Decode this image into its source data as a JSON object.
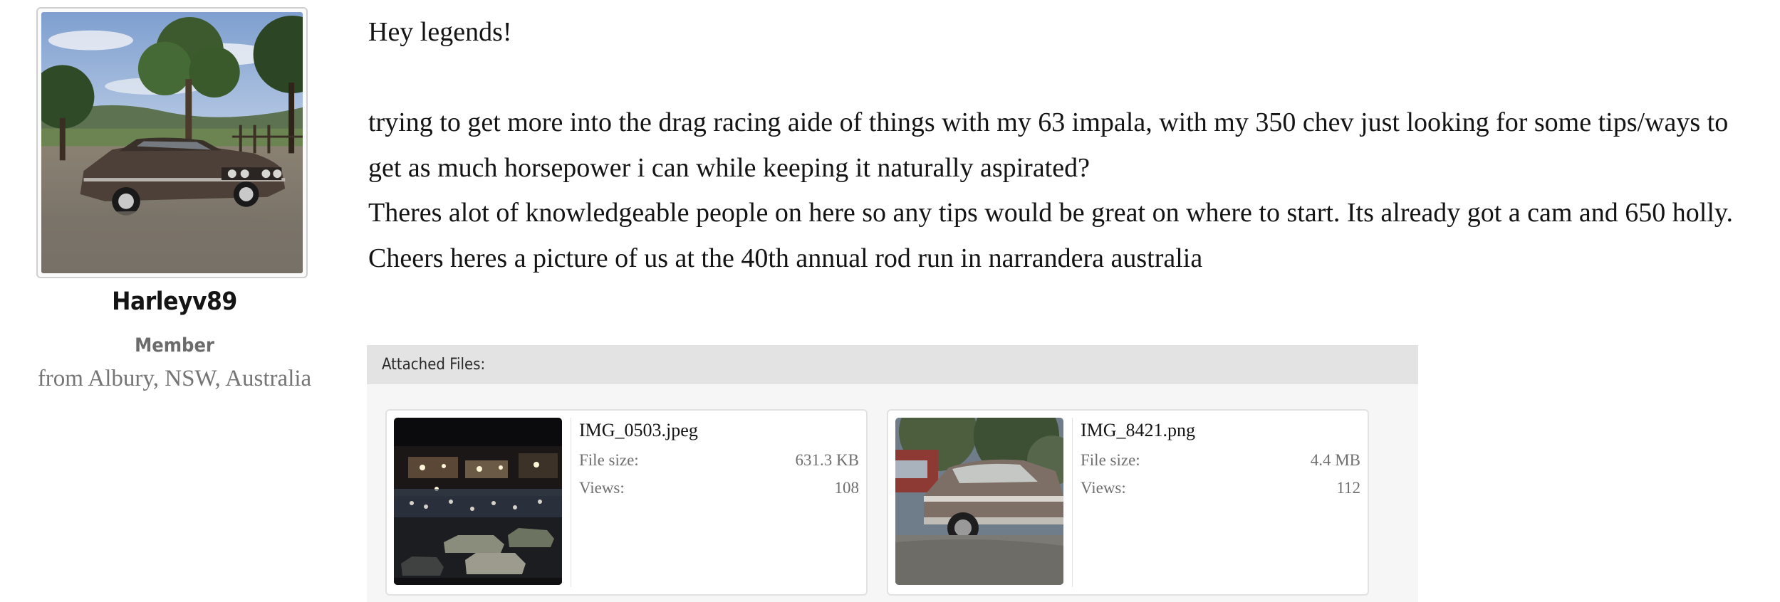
{
  "user": {
    "avatar_icon": "avatar-car-photo",
    "username": "Harleyv89",
    "title": "Member",
    "location": "from Albury, NSW, Australia"
  },
  "message": {
    "paragraphs": [
      "Hey legends!",
      "trying to get more into the drag racing aide of things with my 63 impala, with my 350 chev just looking for some tips/ways to get as much horsepower i can while keeping it naturally aspirated?",
      "Theres alot of knowledgeable people on here so any tips would be great on where to start. Its already got a cam and 650 holly.",
      "Cheers heres a picture of us at the 40th annual rod run in narrandera australia"
    ]
  },
  "attachments": {
    "header": "Attached Files:",
    "files": [
      {
        "name": "IMG_0503.jpeg",
        "size_label": "File size:",
        "size": "631.3 KB",
        "views_label": "Views:",
        "views": "108",
        "thumb_icon": "night-street-photo"
      },
      {
        "name": "IMG_8421.png",
        "size_label": "File size:",
        "size": "4.4 MB",
        "views_label": "Views:",
        "views": "112",
        "thumb_icon": "car-closeup-photo"
      }
    ]
  }
}
